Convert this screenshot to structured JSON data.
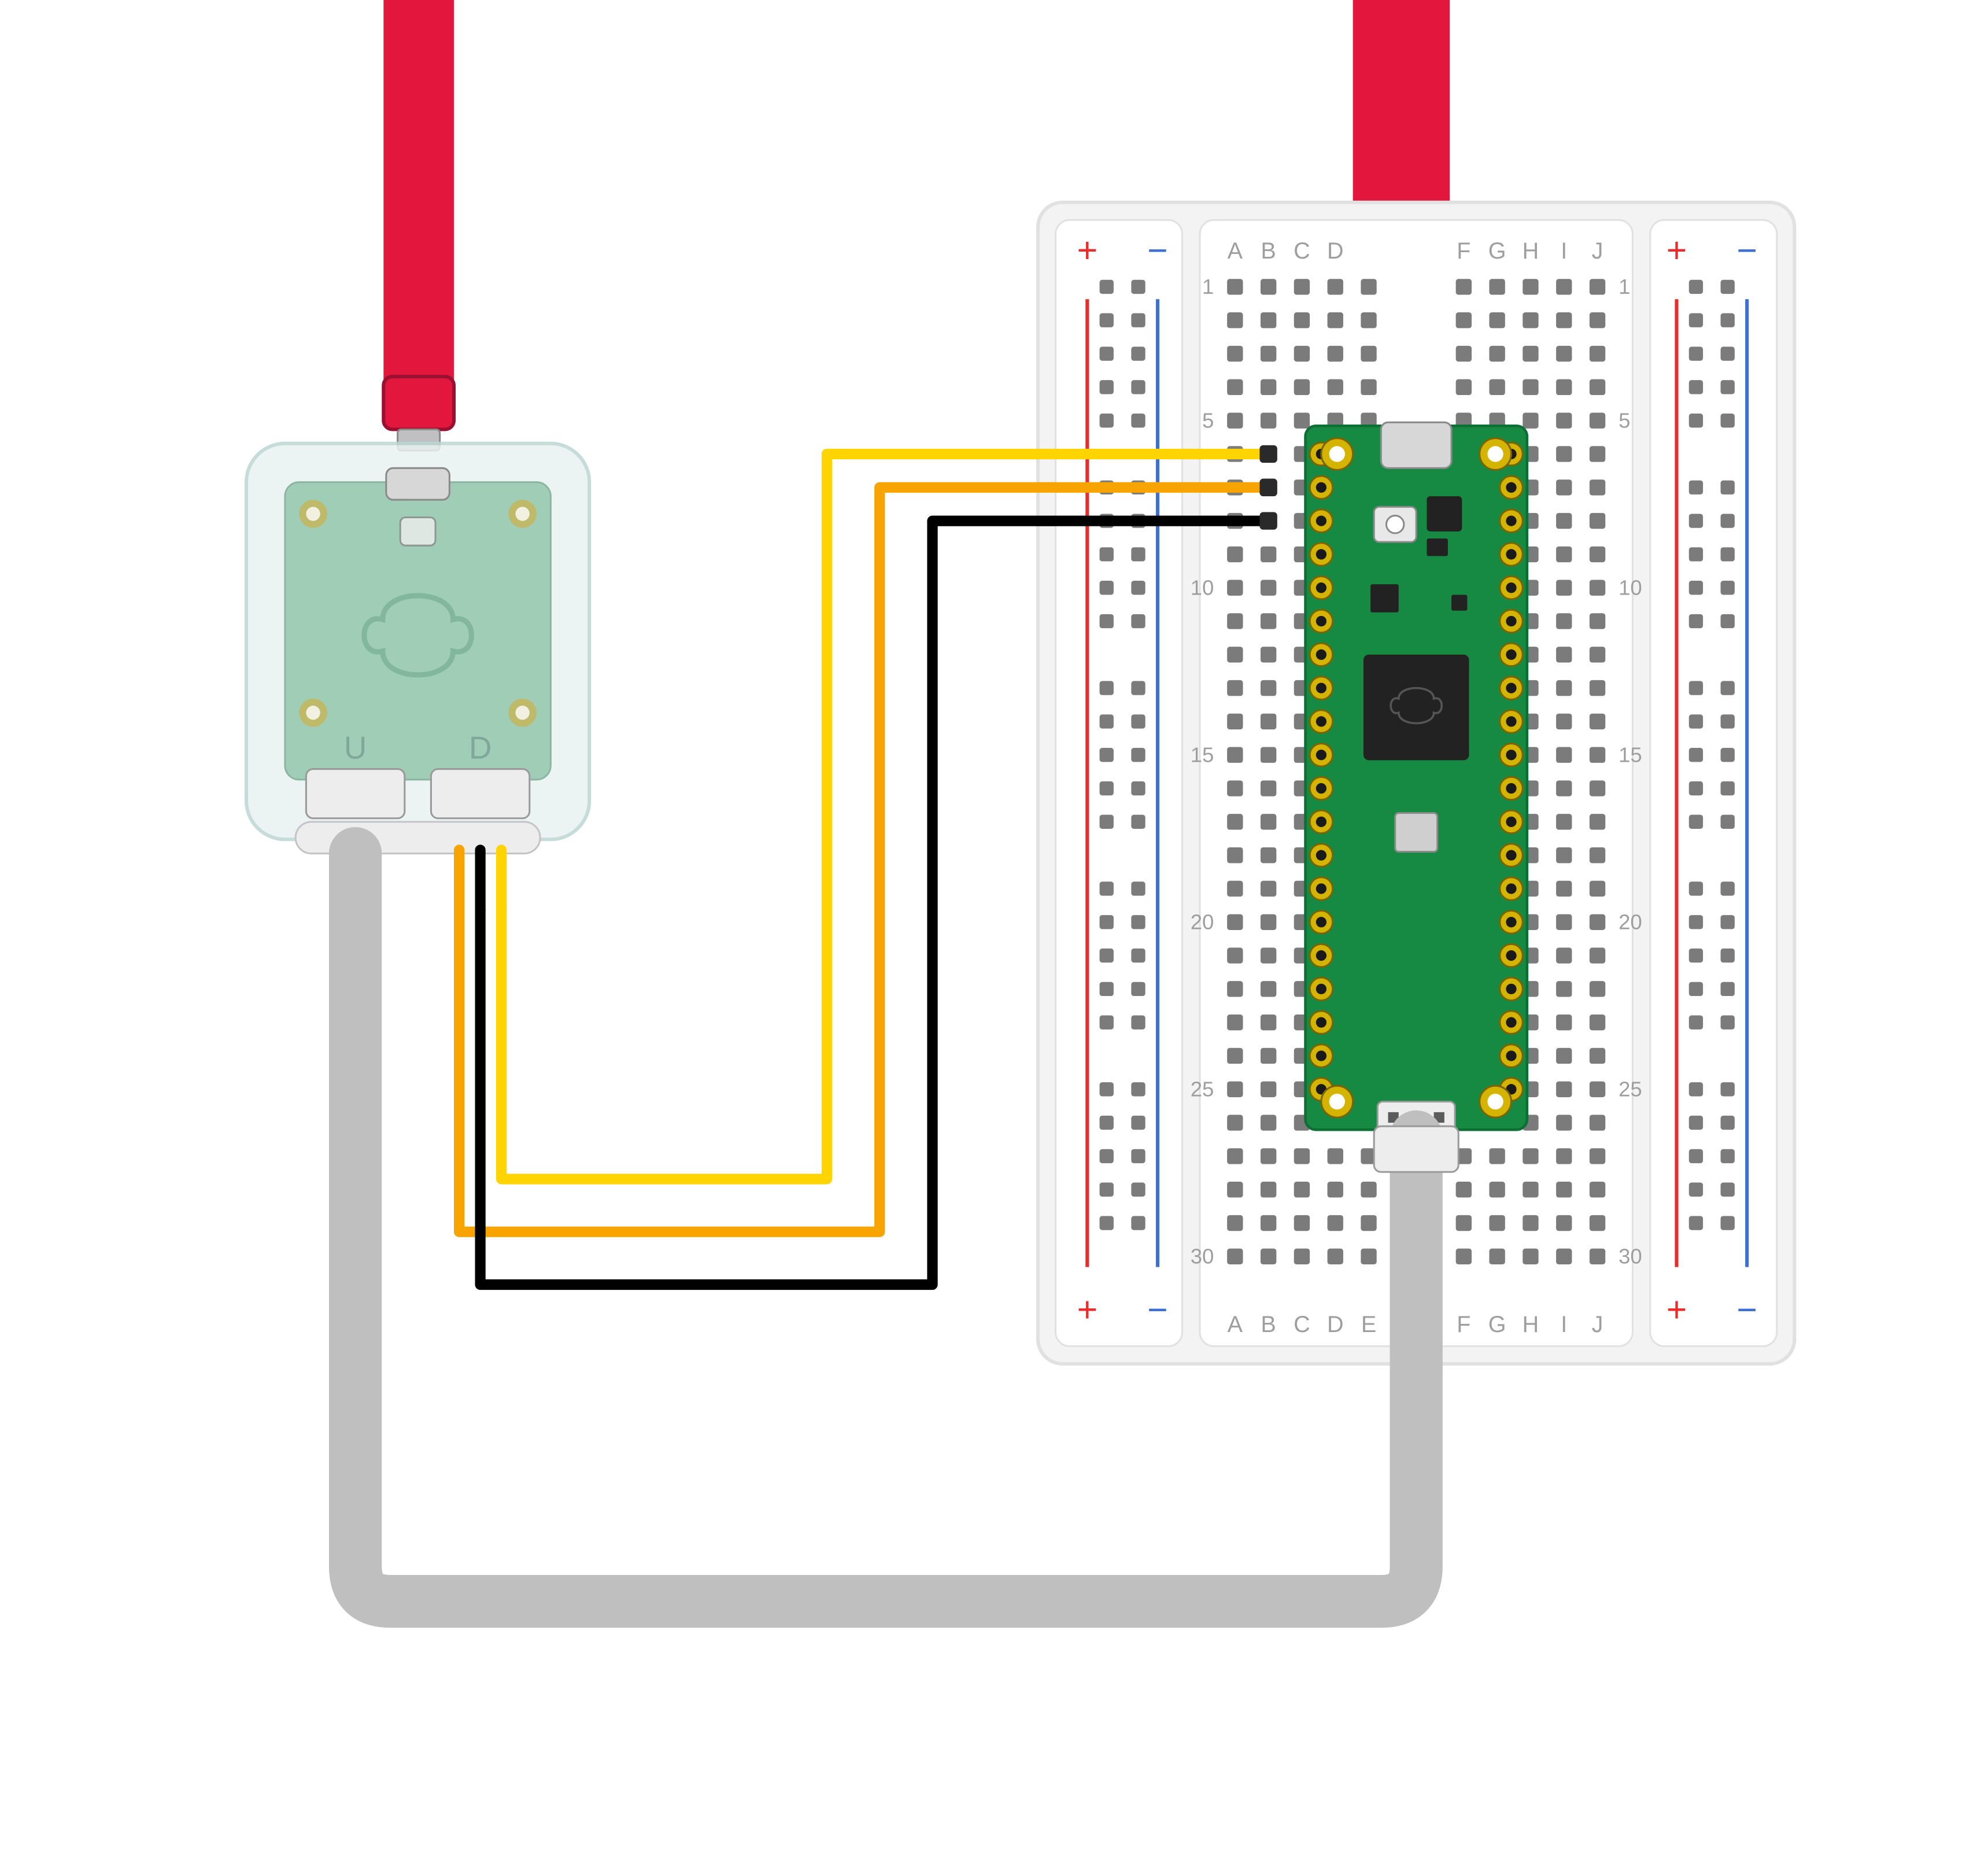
{
  "diagram": {
    "description": "Raspberry Pi Debug Probe (left, in translucent case) connected via 3-wire SWD (orange=SWCLK, black=GND, yellow=SWDIO) to a Raspberry Pi Pico on a half-size breadboard (right). Both boards have red micro-USB cables.",
    "components": {
      "debug_probe": {
        "case_label_left": "U",
        "case_label_right": "D"
      },
      "breadboard": {
        "columns_top": [
          "A",
          "B",
          "C",
          "D",
          "",
          "",
          "F",
          "G",
          "H",
          "I",
          "J"
        ],
        "columns_bottom": [
          "A",
          "B",
          "C",
          "D",
          "E",
          "",
          "F",
          "G",
          "H",
          "I",
          "J"
        ],
        "rows_labeled": [
          1,
          5,
          10,
          15,
          20,
          25,
          30
        ],
        "rail_plus": "+",
        "rail_minus": "−"
      }
    },
    "wires": [
      {
        "name": "swclk",
        "color": "#F7A400",
        "from": "debug_probe.D.pin1",
        "to": "breadboard.B7"
      },
      {
        "name": "swdio",
        "color": "#FFD400",
        "from": "debug_probe.D.pin3",
        "to": "breadboard.B6"
      },
      {
        "name": "gnd",
        "color": "#000000",
        "from": "debug_probe.D.pin2",
        "to": "breadboard.B8"
      }
    ],
    "cables": [
      {
        "name": "usb_probe",
        "color": "#E3173E"
      },
      {
        "name": "usb_pico",
        "color": "#E3173E"
      },
      {
        "name": "uart_ribbon",
        "color": "#BFBFBF"
      }
    ],
    "colors": {
      "usb_red": "#E3173E",
      "breadboard_body": "#F3F3F3",
      "breadboard_edge": "#E1E1E1",
      "breadboard_hole": "#7B7B7B",
      "rail_red": "#EA2C2C",
      "rail_blue": "#3B6FD6",
      "pico_pcb": "#168A43",
      "pico_pad": "#D4B400",
      "pico_chip": "#222222",
      "probe_case": "#E9F2F1",
      "probe_pcb": "#6FB48D",
      "ribbon": "#BFBFBF",
      "stroke": "#8C8C8C",
      "text": "#9E9E9E"
    }
  }
}
